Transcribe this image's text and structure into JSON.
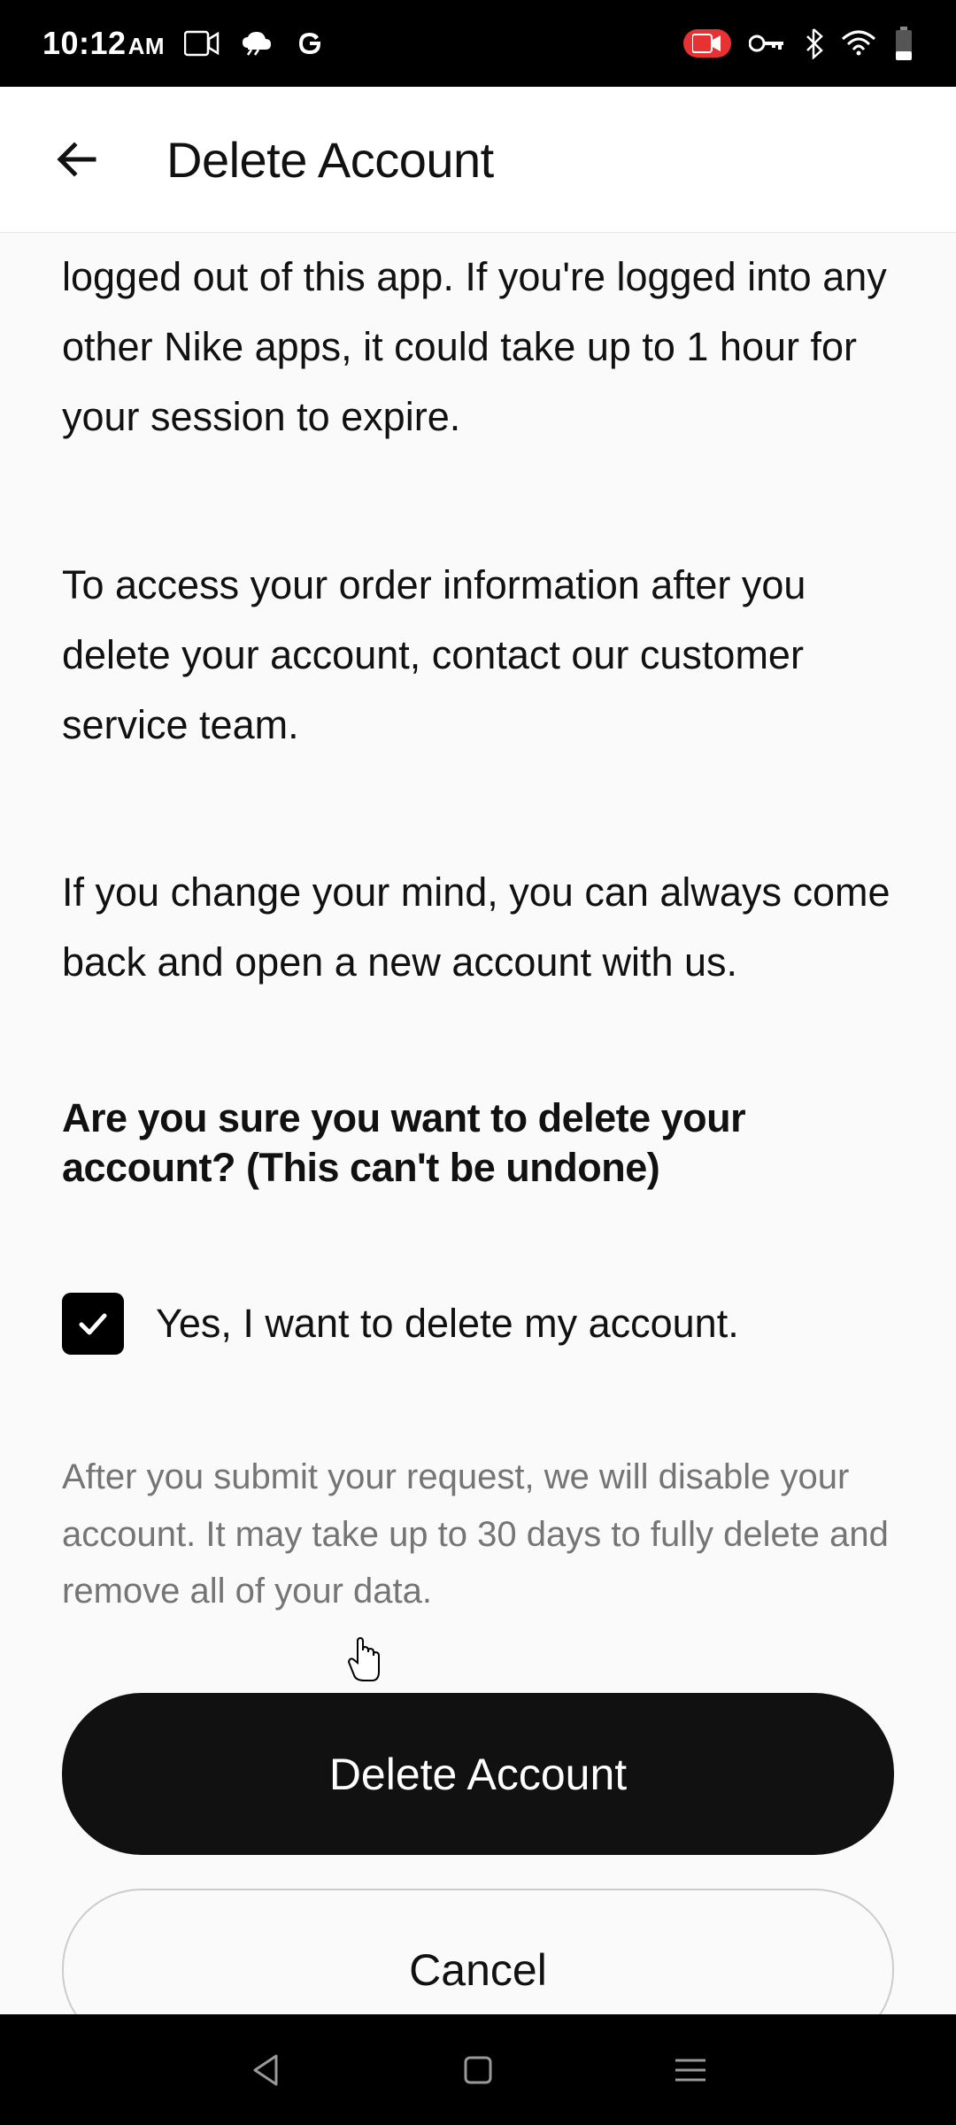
{
  "status": {
    "time": "10:12",
    "ampm": "AM"
  },
  "header": {
    "title": "Delete Account"
  },
  "content": {
    "p1": "logged out of this app. If you're logged into any other Nike apps, it could take up to 1 hour for your session to expire.",
    "p2": "To access your order information after you delete your account, contact our customer service team.",
    "p3": "If you change your mind, you can always come back and open a new account with us.",
    "confirm_question": "Are you sure you want to delete your account? (This can't be undone)",
    "checkbox_checked": true,
    "checkbox_label": "Yes, I want to delete my account.",
    "disclaimer": "After you submit your request, we will disable your account. It may take up to 30 days to fully delete and remove all of your data.",
    "delete_button": "Delete Account",
    "cancel_button": "Cancel"
  }
}
